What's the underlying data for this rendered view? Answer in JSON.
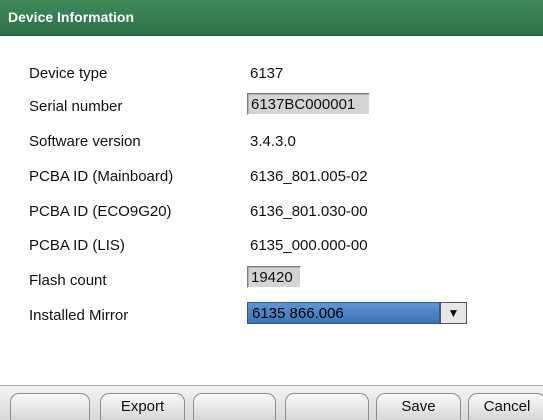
{
  "window": {
    "title": "Device Information"
  },
  "rows": [
    {
      "label": "Device type",
      "value": "6137"
    },
    {
      "label": "Serial number",
      "value": "6137BC000001"
    },
    {
      "label": "Software version",
      "value": "3.4.3.0"
    },
    {
      "label": "PCBA ID (Mainboard)",
      "value": "6136_801.005-02"
    },
    {
      "label": "PCBA ID (ECO9G20)",
      "value": "6136_801.030-00"
    },
    {
      "label": "PCBA ID (LIS)",
      "value": "6135_000.000-00"
    },
    {
      "label": "Flash count",
      "value": "19420"
    },
    {
      "label": "Installed Mirror",
      "value": "6135 866.006"
    }
  ],
  "icons": {
    "dropdown": "triangle-down-icon"
  },
  "colors": {
    "titlebar": "#2e7048",
    "selection": "#4a80c4"
  },
  "footer": {
    "buttons": [
      "",
      "Export",
      "",
      "",
      "Save",
      "Cancel"
    ]
  }
}
